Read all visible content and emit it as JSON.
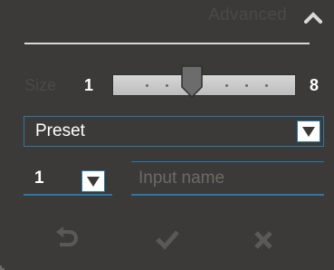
{
  "header": {
    "title": "Advanced",
    "collapse_icon": "chevron-up-icon"
  },
  "slider": {
    "label": "Size",
    "min_label": "1",
    "max_label": "8",
    "value_fraction": 0.43
  },
  "preset": {
    "selected": "Preset",
    "arrow_icon": "triangle-down-icon"
  },
  "count": {
    "selected": "1",
    "arrow_icon": "triangle-down-icon"
  },
  "name_input": {
    "value": "",
    "placeholder": "Input name"
  },
  "actions": {
    "undo_icon": "undo-icon",
    "confirm_icon": "check-icon",
    "close_icon": "close-icon"
  },
  "colors": {
    "background": "#3b3a38",
    "accent": "#2a78a8",
    "muted_text": "#4a4946",
    "icon": "#5a5956"
  }
}
